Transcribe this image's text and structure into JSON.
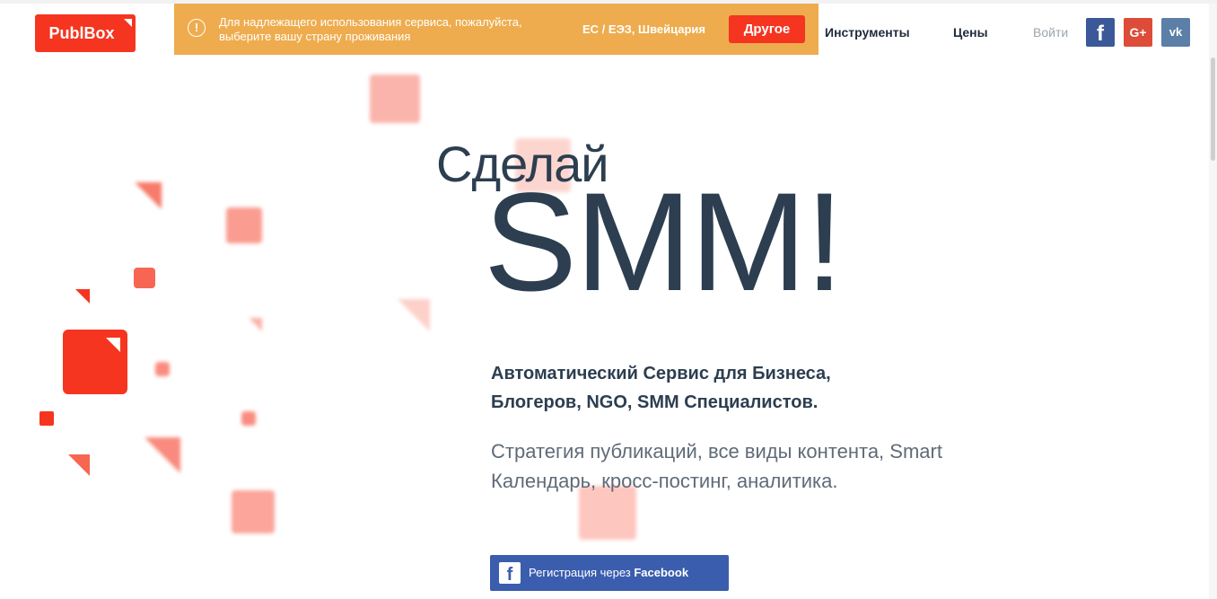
{
  "header": {
    "logo_text": "PublBox",
    "nav": {
      "tools": "Инструменты",
      "prices": "Цены",
      "login": "Войти"
    },
    "social": {
      "facebook": "f",
      "googleplus": "G+",
      "vk": "vk"
    }
  },
  "banner": {
    "warning_glyph": "!",
    "message": "Для надлежащего использования сервиса, пожалуйста, выберите вашу страну проживания",
    "region": "ЕС / ЕЭЗ, Швейцария",
    "other_button": "Другое"
  },
  "hero": {
    "line1": "Сделай",
    "line2": "SMM!",
    "tagline": "Автоматический Сервис для Бизнеса, Блогеров, NGO, SMM Специалистов.",
    "description": "Стратегия публикаций, все виды контента, Smart Календарь, кросс-постинг, аналитика.",
    "fb_register_prefix": "Регистрация через ",
    "fb_register_brand": "Facebook"
  },
  "colors": {
    "brand": "#f5351f",
    "banner": "#eeac4e",
    "facebook": "#3b5998",
    "googleplus": "#dd4b39",
    "vk": "#5b7fa6",
    "text_dark": "#2c3e50"
  }
}
